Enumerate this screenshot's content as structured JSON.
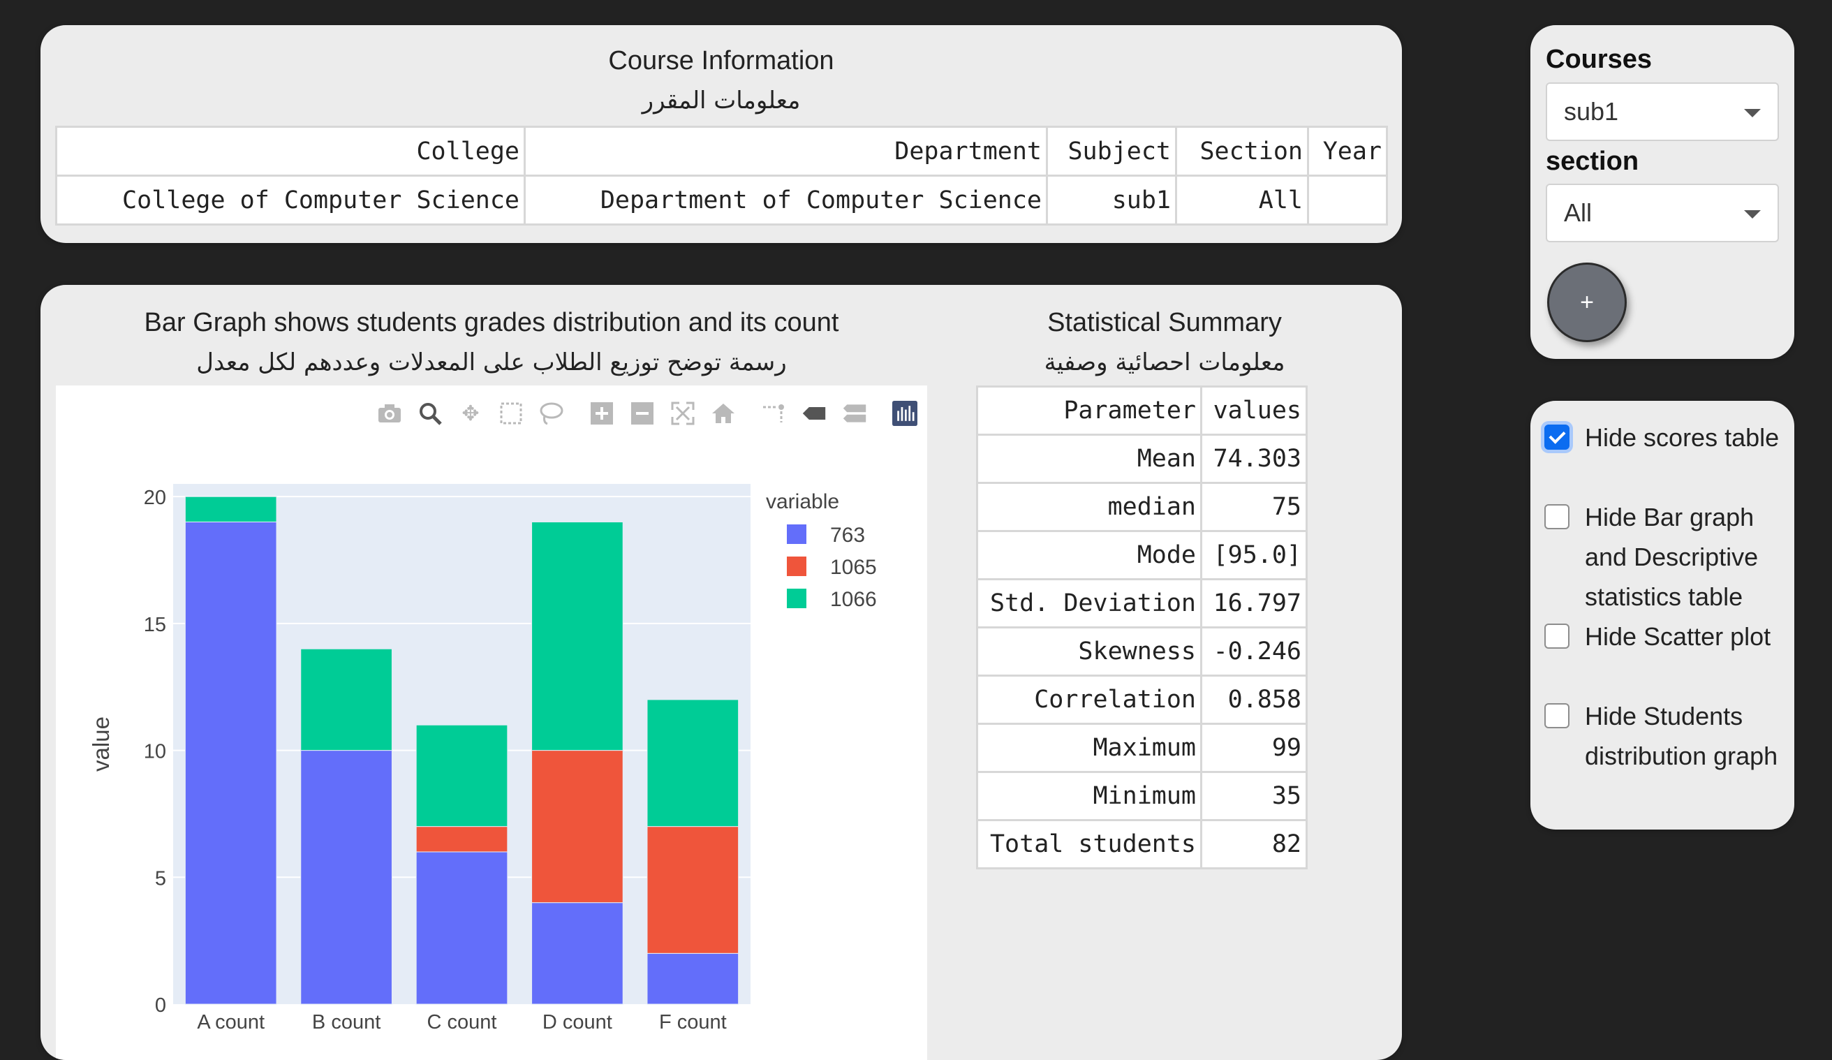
{
  "course_info": {
    "title": "Course Information",
    "subtitle": "معلومات المقرر",
    "columns": [
      "College",
      "Department",
      "Subject",
      "Section",
      "Year"
    ],
    "row": [
      "College of Computer Science",
      "Department of Computer Science",
      "sub1",
      "All",
      ""
    ]
  },
  "graph": {
    "title": "Bar Graph shows students grades distribution and its count",
    "subtitle": "رسمة توضح توزيع الطلاب على المعدلات وعددهم لكل معدل"
  },
  "stats": {
    "title": "Statistical Summary",
    "subtitle": "معلومات احصائية وصفية",
    "columns": [
      "Parameter",
      "values"
    ],
    "rows": [
      [
        "Mean",
        "74.303"
      ],
      [
        "median",
        "75"
      ],
      [
        "Mode",
        "[95.0]"
      ],
      [
        "Std. Deviation",
        "16.797"
      ],
      [
        "Skewness",
        "-0.246"
      ],
      [
        "Correlation",
        "0.858"
      ],
      [
        "Maximum",
        "99"
      ],
      [
        "Minimum",
        "35"
      ],
      [
        "Total students",
        "82"
      ]
    ]
  },
  "chart_data": {
    "type": "bar",
    "stacked": true,
    "categories": [
      "A count",
      "B count",
      "C count",
      "D count",
      "F count"
    ],
    "series": [
      {
        "name": "763",
        "color": "#636efa",
        "values": [
          19,
          10,
          6,
          4,
          2
        ]
      },
      {
        "name": "1065",
        "color": "#ef553b",
        "values": [
          0,
          0,
          1,
          6,
          5
        ]
      },
      {
        "name": "1066",
        "color": "#00cc96",
        "values": [
          1,
          4,
          4,
          9,
          5
        ]
      }
    ],
    "xlabel": "",
    "ylabel": "value",
    "ylim": [
      0,
      20.5
    ],
    "yticks": [
      0,
      5,
      10,
      15,
      20
    ],
    "legend_title": "variable",
    "legend_position": "top-right",
    "plot_bg": "#e5ecf6",
    "grid": true
  },
  "sidebar": {
    "courses_label": "Courses",
    "course_value": "sub1",
    "section_label": "section",
    "section_value": "All",
    "add_label": "+"
  },
  "options": [
    {
      "label": "Hide scores table",
      "checked": true
    },
    {
      "label": "Hide Bar graph and Descriptive statistics table",
      "checked": false
    },
    {
      "label": "Hide Scatter plot",
      "checked": false
    },
    {
      "label": "Hide Students distribution graph",
      "checked": false
    }
  ],
  "modebar_icons": [
    "camera-icon",
    "zoom-icon",
    "pan-icon",
    "box-select-icon",
    "lasso-icon",
    "zoom-in-icon",
    "zoom-out-icon",
    "autoscale-icon",
    "reset-axes-icon",
    "spike-lines-icon",
    "hover-closest-icon",
    "hover-compare-icon",
    "plotly-logo-icon"
  ]
}
